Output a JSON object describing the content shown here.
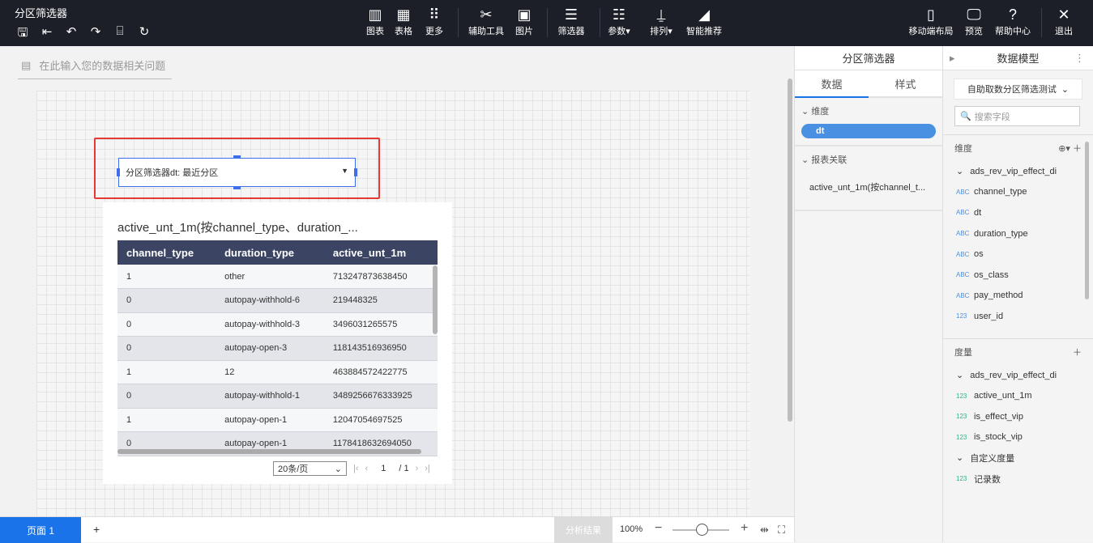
{
  "app": {
    "title": "分区筛选器"
  },
  "toolbar": {
    "quick": [
      "save-icon",
      "back-icon",
      "undo-icon",
      "redo-icon",
      "format-painter-icon",
      "refresh-icon"
    ],
    "items": [
      {
        "label": "图表",
        "icon": "▥"
      },
      {
        "label": "表格",
        "icon": "▦"
      },
      {
        "label": "更多",
        "icon": "⠿"
      },
      {
        "label": "辅助工具",
        "icon": "✂"
      },
      {
        "label": "图片",
        "icon": "▣"
      },
      {
        "label": "筛选器",
        "icon": "☰"
      },
      {
        "label": "参数▾",
        "icon": "☷"
      },
      {
        "label": "排列▾",
        "icon": "⍊"
      },
      {
        "label": "智能推荐",
        "icon": "◢"
      }
    ],
    "right": [
      {
        "label": "移动端布局",
        "icon": "▯"
      },
      {
        "label": "预览",
        "icon": "🖵"
      },
      {
        "label": "帮助中心",
        "icon": "?"
      },
      {
        "label": "退出",
        "icon": "✕"
      }
    ]
  },
  "question": {
    "placeholder": "在此输入您的数据相关问题"
  },
  "filter": {
    "label": "分区筛选器dt: 最近分区"
  },
  "table_card": {
    "title": "active_unt_1m(按channel_type、duration_...",
    "columns": [
      "channel_type",
      "duration_type",
      "active_unt_1m"
    ],
    "rows": [
      [
        "1",
        "other",
        "713247873638450"
      ],
      [
        "0",
        "autopay-withhold-6",
        "219448325"
      ],
      [
        "0",
        "autopay-withhold-3",
        "3496031265575"
      ],
      [
        "0",
        "autopay-open-3",
        "118143516936950"
      ],
      [
        "1",
        "12",
        "463884572422775"
      ],
      [
        "0",
        "autopay-withhold-1",
        "3489256676333925"
      ],
      [
        "1",
        "autopay-open-1",
        "12047054697525"
      ],
      [
        "0",
        "autopay-open-1",
        "1178418632694050"
      ]
    ],
    "page_size": "20条/页",
    "page": "1",
    "total_pages": "/ 1"
  },
  "bottom": {
    "page_tab": "页面 1",
    "add": "+",
    "analysis": "分析结果",
    "zoom": "100%",
    "minus": "−",
    "plus": "+",
    "zoom_fraction": 0.5
  },
  "config_panel": {
    "title": "分区筛选器",
    "tabs": [
      "数据",
      "样式"
    ],
    "dimension_label": "维度",
    "dimension_field": "dt",
    "relation_label": "报表关联",
    "relation_item": "active_unt_1m(按channel_t..."
  },
  "model_panel": {
    "title": "数据模型",
    "dataset": "自助取数分区筛选测试",
    "search_placeholder": "搜索字段",
    "dim_label": "维度",
    "dim_table": "ads_rev_vip_effect_di",
    "dims": [
      {
        "t": "ABC",
        "n": "channel_type"
      },
      {
        "t": "ABC",
        "n": "dt"
      },
      {
        "t": "ABC",
        "n": "duration_type"
      },
      {
        "t": "ABC",
        "n": "os"
      },
      {
        "t": "ABC",
        "n": "os_class"
      },
      {
        "t": "ABC",
        "n": "pay_method"
      },
      {
        "t": "123",
        "n": "user_id"
      }
    ],
    "measure_label": "度量",
    "measure_table": "ads_rev_vip_effect_di",
    "measures": [
      {
        "t": "123",
        "n": "active_unt_1m"
      },
      {
        "t": "123",
        "n": "is_effect_vip"
      },
      {
        "t": "123",
        "n": "is_stock_vip"
      }
    ],
    "custom_label": "自定义度量",
    "custom": [
      {
        "t": "123",
        "n": "记录数"
      }
    ]
  }
}
